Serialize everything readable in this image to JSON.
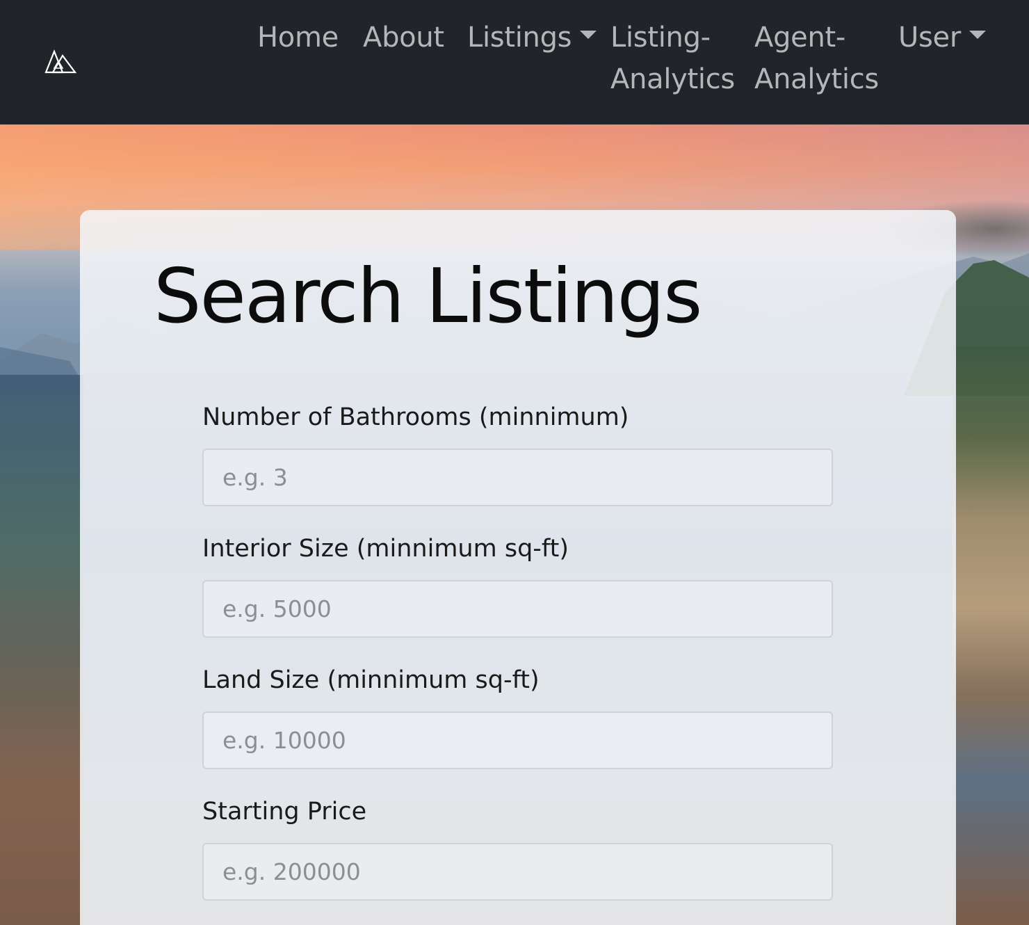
{
  "navbar": {
    "brand_icon": "mountain-logo-icon",
    "links": {
      "home": "Home",
      "about": "About",
      "listings": "Listings",
      "listing_analytics_line1": "Listing-",
      "listing_analytics_line2": "Analytics",
      "agent_analytics_line1": "Agent-",
      "agent_analytics_line2": "Analytics",
      "user": "User"
    }
  },
  "search": {
    "title": "Search Listings",
    "fields": [
      {
        "label": "Number of Bathrooms (minnimum)",
        "placeholder": "e.g. 3",
        "value": ""
      },
      {
        "label": "Interior Size (minnimum sq-ft)",
        "placeholder": "e.g. 5000",
        "value": ""
      },
      {
        "label": "Land Size (minnimum sq-ft)",
        "placeholder": "e.g. 10000",
        "value": ""
      },
      {
        "label": "Starting Price",
        "placeholder": "e.g. 200000",
        "value": ""
      }
    ]
  },
  "colors": {
    "navbar_bg": "#212529",
    "nav_link": "#b4b6b9",
    "card_bg": "#f2f5f8",
    "title_text": "#0c0c0c"
  }
}
